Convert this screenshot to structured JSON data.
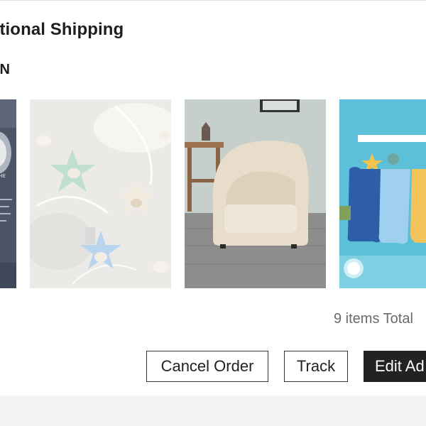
{
  "order": {
    "shipping_title": "ational Shipping",
    "status_label": "IN",
    "items_total": "9 items Total"
  },
  "thumbnails": [
    {
      "icon": "book-cover-image"
    },
    {
      "icon": "star-ornaments-image"
    },
    {
      "icon": "armchair-image"
    },
    {
      "icon": "hand-towels-image"
    }
  ],
  "actions": {
    "cancel_label": "Cancel Order",
    "track_label": "Track",
    "edit_label": "Edit Ad"
  },
  "colors": {
    "button_dark": "#222222",
    "button_outline_border": "#333333",
    "muted_text": "#6a6a6a",
    "page_background": "#f4f4f4"
  }
}
